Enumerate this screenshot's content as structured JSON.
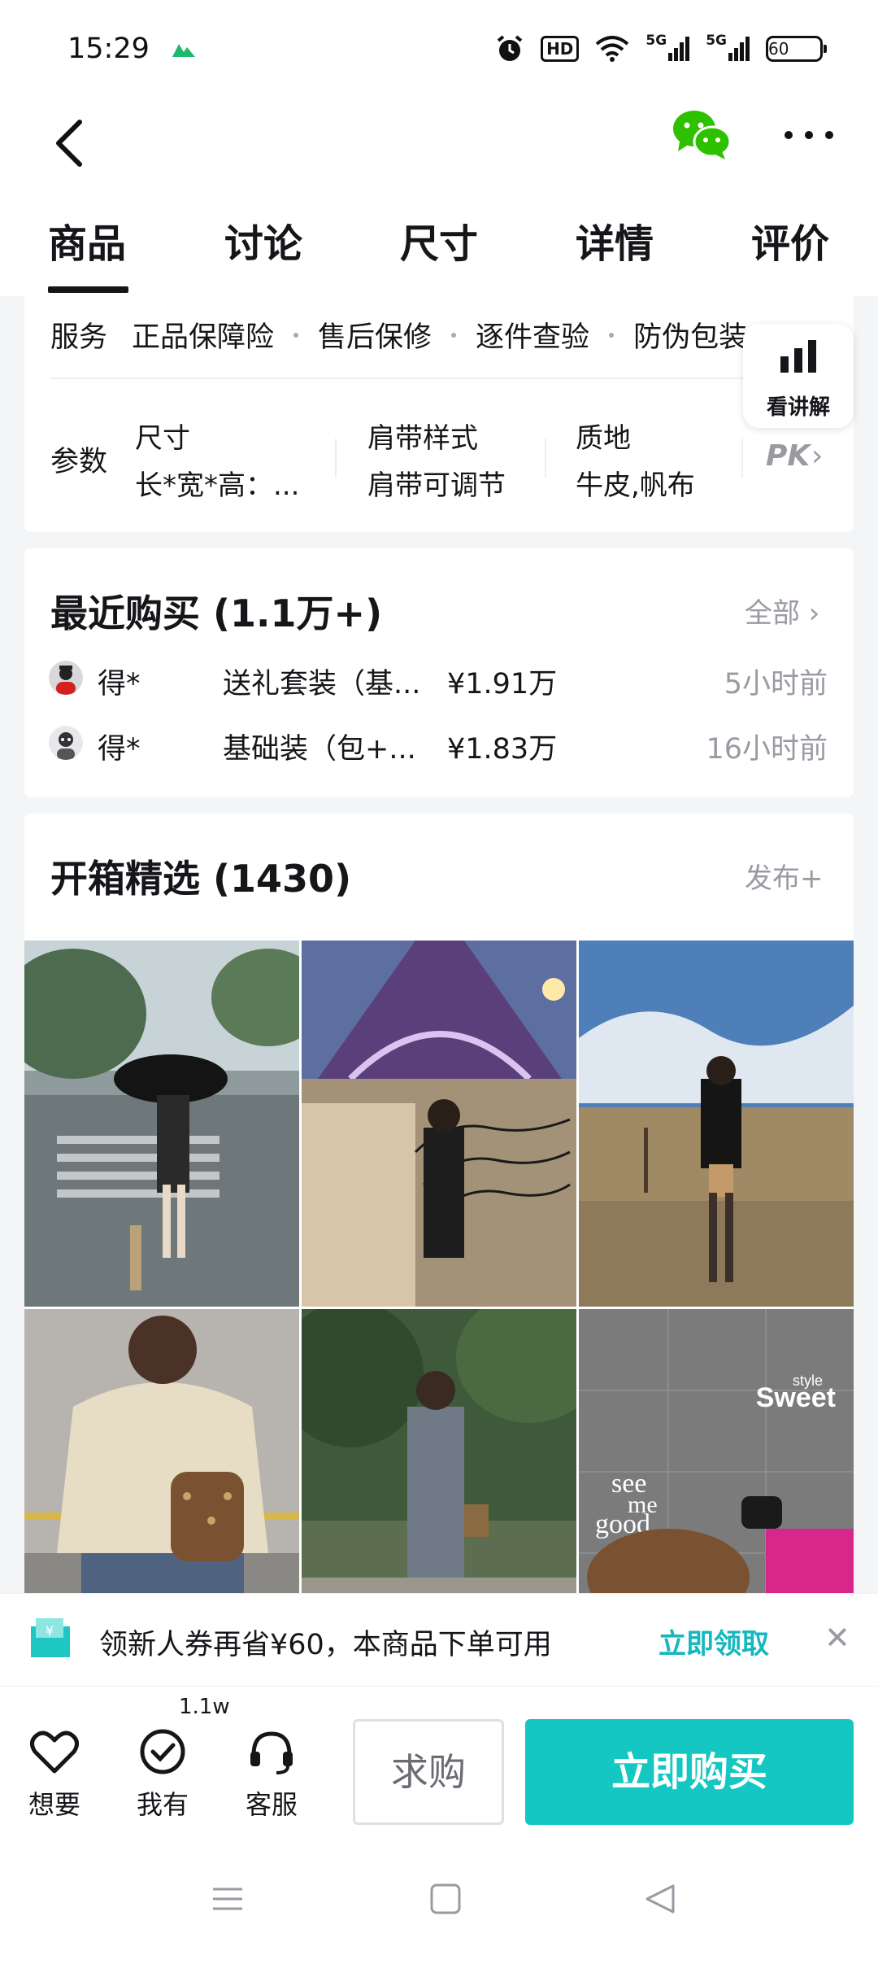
{
  "status_bar": {
    "time": "15:29",
    "hd_label": "HD",
    "signal_label_1": "5G",
    "signal_label_2": "5G",
    "battery": "60"
  },
  "tabs": [
    {
      "label": "商品",
      "active": true
    },
    {
      "label": "讨论"
    },
    {
      "label": "尺寸"
    },
    {
      "label": "详情"
    },
    {
      "label": "评价"
    }
  ],
  "service": {
    "label": "服务",
    "items": [
      "正品保障险",
      "售后保修",
      "逐件查验",
      "防伪包装"
    ]
  },
  "params": {
    "label": "参数",
    "columns": [
      {
        "name": "尺寸",
        "value": "长*宽*高：..."
      },
      {
        "name": "肩带样式",
        "value": "肩带可调节"
      },
      {
        "name": "质地",
        "value": "牛皮,帆布"
      }
    ],
    "pk_label": "PK"
  },
  "float_explain": {
    "label": "看讲解"
  },
  "recent_purchases": {
    "title": "最近购买 (1.1万+)",
    "all_label": "全部",
    "items": [
      {
        "name": "得*",
        "spec": "送礼套装（基...",
        "price": "¥1.91万",
        "time": "5小时前"
      },
      {
        "name": "得*",
        "spec": "基础装（包+...",
        "price": "¥1.83万",
        "time": "16小时前"
      }
    ]
  },
  "unboxing": {
    "title": "开箱精选 (1430)",
    "publish_label": "发布+",
    "photo_6_text": {
      "sweet": "Sweet",
      "style": "style",
      "see": "see",
      "me": "me",
      "good": "good"
    }
  },
  "coupon": {
    "text": "领新人券再省¥60，本商品下单可用",
    "claim_label": "立即领取",
    "close_glyph": "✕"
  },
  "actions": {
    "want": "想要",
    "have": "我有",
    "have_count": "1.1w",
    "service": "客服",
    "request": "求购",
    "buy": "立即购买"
  },
  "colors": {
    "accent": "#15c7c3",
    "accent_text": "#14b8bd",
    "muted": "#9a9aa3",
    "wechat": "#2dc100"
  }
}
